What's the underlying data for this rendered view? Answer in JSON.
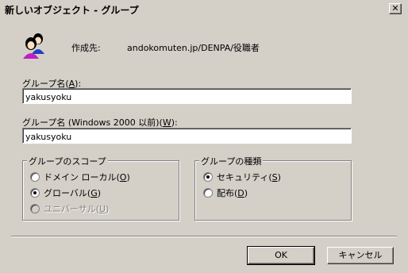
{
  "window": {
    "title": "新しいオブジェクト - グループ",
    "close_glyph": "✕"
  },
  "header": {
    "created_in_label": "作成先:",
    "created_in_path": "andokomuten.jp/DENPA/役職者",
    "icon": "group-users-icon"
  },
  "group_name": {
    "label_prefix": "グループ名(",
    "label_key": "A",
    "label_suffix": "):",
    "value": "yakusyoku"
  },
  "group_name_pre2000": {
    "label_prefix": "グループ名 (Windows 2000 以前)(",
    "label_key": "W",
    "label_suffix": "):",
    "value": "yakusyoku"
  },
  "scope": {
    "title": "グループのスコープ",
    "options": [
      {
        "label": "ドメイン ローカル(",
        "key": "O",
        "suffix": ")",
        "checked": false,
        "disabled": false
      },
      {
        "label": "グローバル(",
        "key": "G",
        "suffix": ")",
        "checked": true,
        "disabled": false
      },
      {
        "label": "ユニバーサル(",
        "key": "U",
        "suffix": ")",
        "checked": false,
        "disabled": true
      }
    ]
  },
  "type": {
    "title": "グループの種類",
    "options": [
      {
        "label": "セキュリティ(",
        "key": "S",
        "suffix": ")",
        "checked": true
      },
      {
        "label": "配布(",
        "key": "D",
        "suffix": ")",
        "checked": false
      }
    ]
  },
  "buttons": {
    "ok": "OK",
    "cancel": "キャンセル"
  },
  "colors": {
    "face": "#d4d0c8",
    "shadow": "#808080",
    "highlight": "#ffffff"
  }
}
